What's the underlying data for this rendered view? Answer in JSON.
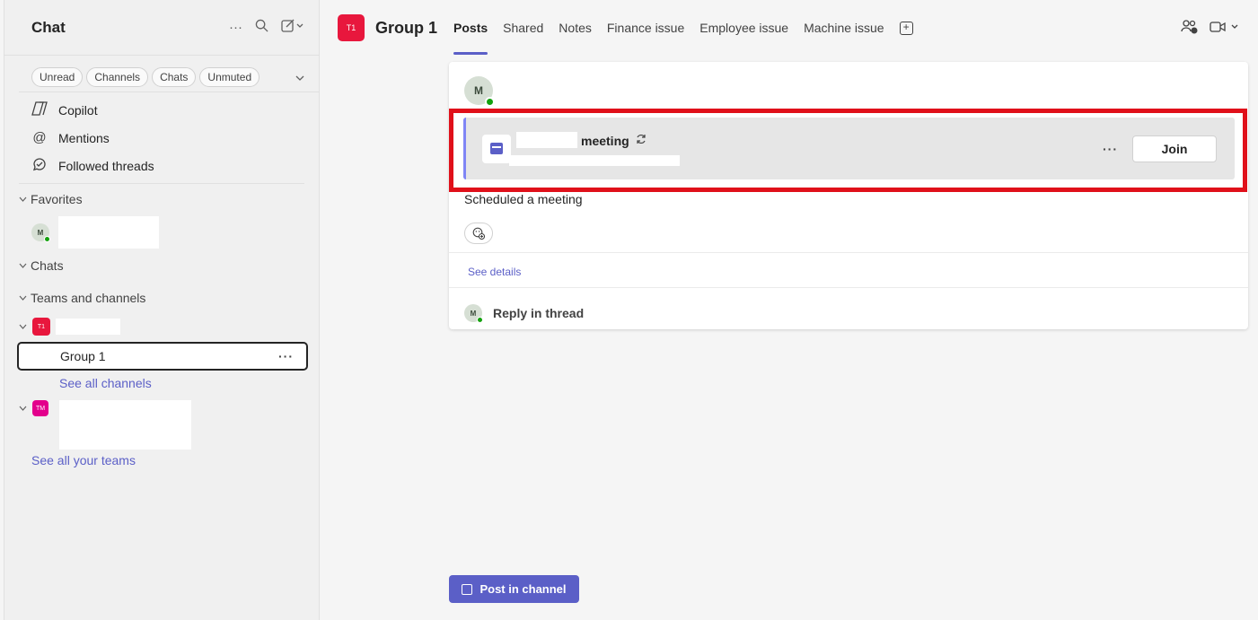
{
  "sidebar": {
    "title": "Chat",
    "filters": [
      "Unread",
      "Channels",
      "Chats",
      "Unmuted"
    ],
    "nav": [
      {
        "label": "Copilot",
        "icon": "copilot-icon"
      },
      {
        "label": "Mentions",
        "icon": "at-icon"
      },
      {
        "label": "Followed threads",
        "icon": "followed-threads-icon"
      }
    ],
    "favorites_label": "Favorites",
    "favorites_avatar": "M",
    "chats_label": "Chats",
    "teams_label": "Teams and channels",
    "team1_badge": "T1",
    "channel_name": "Group 1",
    "see_all_channels": "See all channels",
    "team2_badge": "TM",
    "see_all_teams": "See all your teams"
  },
  "header": {
    "badge": "T1",
    "title": "Group 1",
    "tabs": [
      "Posts",
      "Shared",
      "Notes",
      "Finance issue",
      "Employee issue",
      "Machine issue"
    ],
    "active_tab": "Posts"
  },
  "post": {
    "author_initial": "M",
    "meeting_title": "meeting",
    "join_label": "Join",
    "scheduled_text": "Scheduled a meeting",
    "see_details": "See details",
    "reply_initial": "M",
    "reply_label": "Reply in thread"
  },
  "compose": {
    "post_button": "Post in channel"
  },
  "colors": {
    "accent": "#5b5fc7",
    "team1": "#e8173d",
    "team2": "#e3008c",
    "highlight": "#e0101a",
    "presence": "#13a10e"
  }
}
